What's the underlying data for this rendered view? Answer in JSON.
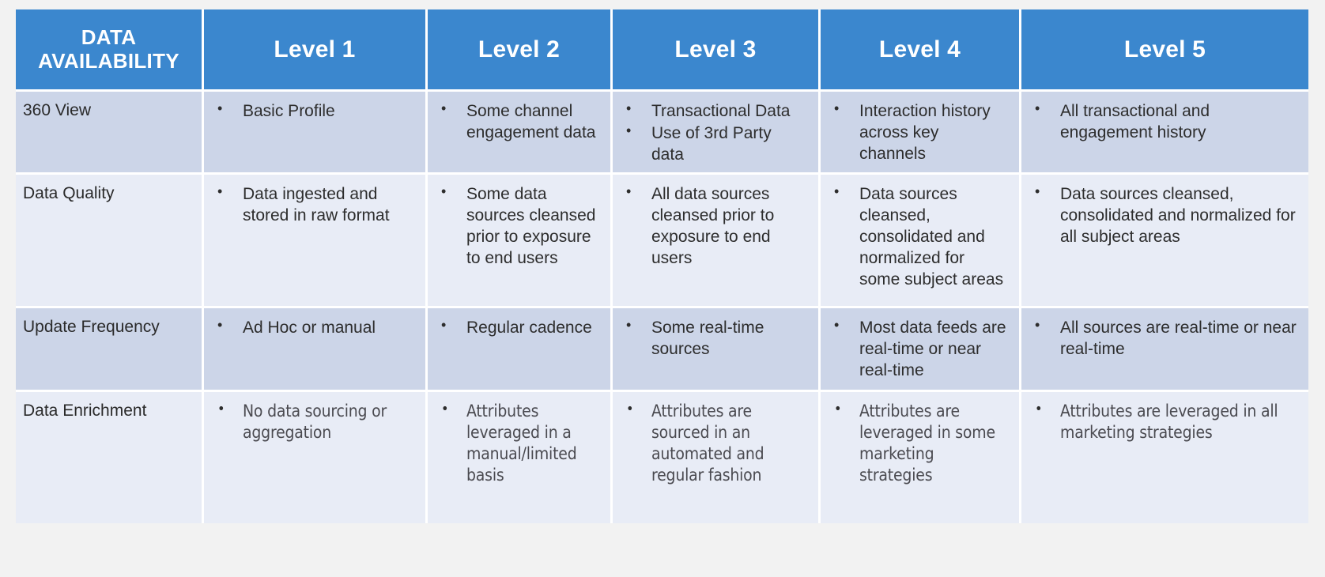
{
  "table": {
    "title": "DATA AVAILABILITY",
    "colors": {
      "header_blue": "#3b87ce",
      "header_text": "#ffffff",
      "row_shade_dark": "#ccd5e8",
      "row_shade_light": "#e8ecf6",
      "page_background": "#f2f2f2",
      "body_text": "#2d2d2d"
    },
    "headers": [
      "DATA AVAILABILITY",
      "Level 1",
      "Level 2",
      "Level 3",
      "Level 4",
      "Level 5"
    ],
    "rows": [
      {
        "label": "360 View",
        "cells": [
          [
            "Basic Profile"
          ],
          [
            "Some channel engagement data"
          ],
          [
            "Transactional Data",
            "Use of 3rd Party data"
          ],
          [
            "Interaction history across key channels"
          ],
          [
            "All transactional and engagement history"
          ]
        ]
      },
      {
        "label": "Data Quality",
        "cells": [
          [
            "Data ingested and stored in raw format"
          ],
          [
            "Some data sources cleansed prior to exposure to end users"
          ],
          [
            "All data sources cleansed prior to exposure to end users"
          ],
          [
            "Data sources cleansed, consolidated and normalized for some subject areas"
          ],
          [
            "Data sources cleansed, consolidated and normalized for all subject areas"
          ]
        ]
      },
      {
        "label": "Update Frequency",
        "cells": [
          [
            "Ad Hoc or manual"
          ],
          [
            "Regular cadence"
          ],
          [
            "Some real-time sources"
          ],
          [
            "Most data feeds are real-time or near real-time"
          ],
          [
            "All sources are real-time or near real-time"
          ]
        ]
      },
      {
        "label": "Data Enrichment",
        "cells": [
          [
            "No data sourcing or aggregation"
          ],
          [
            "Attributes leveraged in a manual/limited basis"
          ],
          [
            "Attributes are sourced in an automated and regular fashion"
          ],
          [
            "Attributes are leveraged in some marketing strategies"
          ],
          [
            "Attributes are leveraged in all marketing strategies"
          ]
        ]
      }
    ]
  }
}
